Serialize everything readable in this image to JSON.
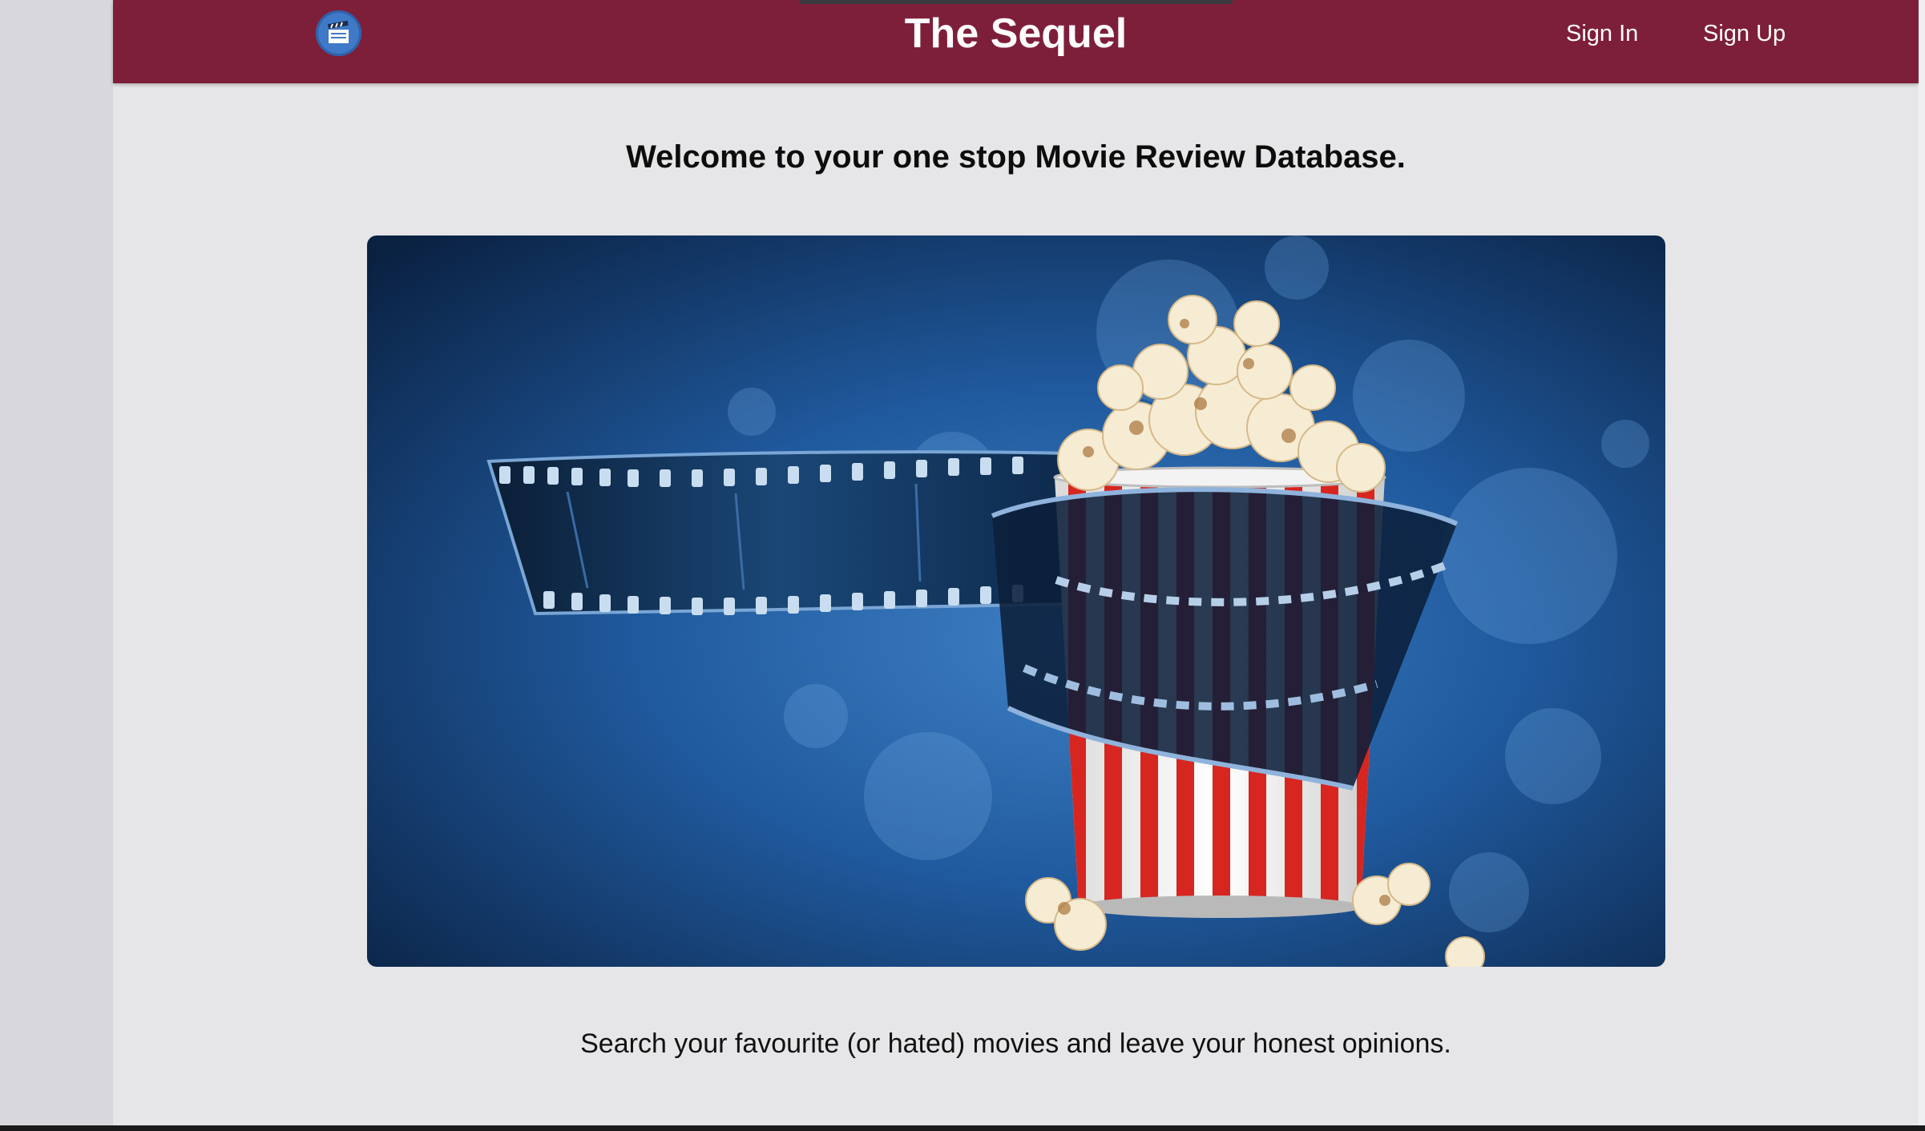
{
  "navbar": {
    "logo_icon": "clapperboard-icon",
    "brand": "The Sequel",
    "sign_in": "Sign In",
    "sign_up": "Sign Up",
    "background_color": "#7e1f39"
  },
  "main": {
    "headline": "Welcome to your one stop Movie Review Database.",
    "hero_image": "popcorn-and-film-reel-image",
    "tagline": "Search your favourite (or hated) movies and leave your honest opinions."
  }
}
